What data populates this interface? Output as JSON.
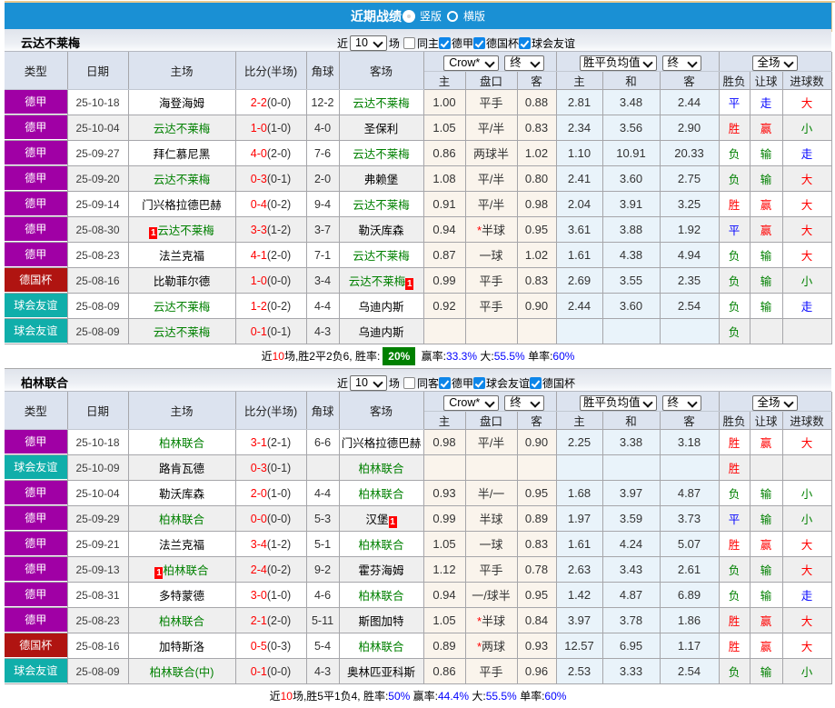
{
  "topbar": {
    "title": "近期战绩",
    "radios": [
      {
        "label": "竖版",
        "checked": true
      },
      {
        "label": "横版",
        "checked": false
      }
    ]
  },
  "colors": {
    "topbar_blue": "#1a90d4",
    "league_purple": "#a000a5",
    "cup_red": "#b01411",
    "friendly_teal": "#10aeaa",
    "header_bg": "#dce3ef",
    "asia_col_bg": "#faf4ec",
    "euro_col_bg": "#e9f3fa",
    "alt_row_bg": "#efefef",
    "win_red": "#ff0000",
    "lose_green": "#008000",
    "draw_blue": "#0000ff",
    "rate_badge_green": "#008000"
  },
  "type_colors": {
    "德甲": "#a000a5",
    "德国杯": "#b01411",
    "球会友谊": "#10aeaa"
  },
  "table_header": {
    "type": "类型",
    "date": "日期",
    "home": "主场",
    "score": "比分(半场)",
    "corner": "角球",
    "away": "客场",
    "selects": {
      "bookmaker": "Crow*",
      "final1": "终",
      "europe": "胜平负均值",
      "final2": "终",
      "scope": "全场"
    },
    "sub": [
      "主",
      "盘口",
      "客",
      "主",
      "和",
      "客",
      "胜负",
      "让球",
      "进球数"
    ]
  },
  "sections": [
    {
      "team": "云达不莱梅",
      "filter": {
        "prefix": "近",
        "count": "10",
        "suffix": "场",
        "same": {
          "label": "同主",
          "checked": false
        },
        "leagues": [
          {
            "label": "德甲",
            "checked": true
          },
          {
            "label": "德国杯",
            "checked": true
          },
          {
            "label": "球会友谊",
            "checked": true
          }
        ]
      },
      "rows": [
        {
          "type": "德甲",
          "date": "25-10-18",
          "home": {
            "name": "海登海姆"
          },
          "score": {
            "ft": "2-2",
            "ht": "(0-0)"
          },
          "corner": "12-2",
          "away": {
            "name": "云达不莱梅",
            "green": true
          },
          "asia": [
            "1.00",
            "平手",
            "0.88"
          ],
          "euro": [
            "2.81",
            "3.48",
            "2.44"
          ],
          "res": [
            [
              "平",
              "blue"
            ],
            [
              "走",
              "blue"
            ],
            [
              "大",
              "red"
            ]
          ]
        },
        {
          "type": "德甲",
          "date": "25-10-04",
          "home": {
            "name": "云达不莱梅",
            "green": true
          },
          "score": {
            "ft": "1-0",
            "ht": "(1-0)"
          },
          "corner": "4-0",
          "away": {
            "name": "圣保利"
          },
          "asia": [
            "1.05",
            "平/半",
            "0.83"
          ],
          "euro": [
            "2.34",
            "3.56",
            "2.90"
          ],
          "res": [
            [
              "胜",
              "red"
            ],
            [
              "赢",
              "red"
            ],
            [
              "小",
              "green"
            ]
          ]
        },
        {
          "type": "德甲",
          "date": "25-09-27",
          "home": {
            "name": "拜仁慕尼黑"
          },
          "score": {
            "ft": "4-0",
            "ht": "(2-0)"
          },
          "corner": "7-6",
          "away": {
            "name": "云达不莱梅",
            "green": true
          },
          "asia": [
            "0.86",
            "两球半",
            "1.02"
          ],
          "euro": [
            "1.10",
            "10.91",
            "20.33"
          ],
          "res": [
            [
              "负",
              "green"
            ],
            [
              "输",
              "green"
            ],
            [
              "走",
              "blue"
            ]
          ]
        },
        {
          "type": "德甲",
          "date": "25-09-20",
          "home": {
            "name": "云达不莱梅",
            "green": true
          },
          "score": {
            "ft": "0-3",
            "ht": "(0-1)"
          },
          "corner": "2-0",
          "away": {
            "name": "弗赖堡"
          },
          "asia": [
            "1.08",
            "平/半",
            "0.80"
          ],
          "euro": [
            "2.41",
            "3.60",
            "2.75"
          ],
          "res": [
            [
              "负",
              "green"
            ],
            [
              "输",
              "green"
            ],
            [
              "大",
              "red"
            ]
          ]
        },
        {
          "type": "德甲",
          "date": "25-09-14",
          "home": {
            "name": "门兴格拉德巴赫"
          },
          "score": {
            "ft": "0-4",
            "ht": "(0-2)"
          },
          "corner": "9-4",
          "away": {
            "name": "云达不莱梅",
            "green": true
          },
          "asia": [
            "0.91",
            "平/半",
            "0.98"
          ],
          "euro": [
            "2.04",
            "3.91",
            "3.25"
          ],
          "res": [
            [
              "胜",
              "red"
            ],
            [
              "赢",
              "red"
            ],
            [
              "大",
              "red"
            ]
          ]
        },
        {
          "type": "德甲",
          "date": "25-08-30",
          "home": {
            "name": "云达不莱梅",
            "green": true,
            "card": "1"
          },
          "score": {
            "ft": "3-3",
            "ht": "(1-2)"
          },
          "corner": "3-7",
          "away": {
            "name": "勒沃库森"
          },
          "asia": [
            "0.94",
            "*半球",
            "0.95"
          ],
          "euro": [
            "3.61",
            "3.88",
            "1.92"
          ],
          "res": [
            [
              "平",
              "blue"
            ],
            [
              "赢",
              "red"
            ],
            [
              "大",
              "red"
            ]
          ]
        },
        {
          "type": "德甲",
          "date": "25-08-23",
          "home": {
            "name": "法兰克福"
          },
          "score": {
            "ft": "4-1",
            "ht": "(2-0)"
          },
          "corner": "7-1",
          "away": {
            "name": "云达不莱梅",
            "green": true
          },
          "asia": [
            "0.87",
            "一球",
            "1.02"
          ],
          "euro": [
            "1.61",
            "4.38",
            "4.94"
          ],
          "res": [
            [
              "负",
              "green"
            ],
            [
              "输",
              "green"
            ],
            [
              "大",
              "red"
            ]
          ]
        },
        {
          "type": "德国杯",
          "date": "25-08-16",
          "home": {
            "name": "比勒菲尔德"
          },
          "score": {
            "ft": "1-0",
            "ht": "(0-0)"
          },
          "corner": "3-4",
          "away": {
            "name": "云达不莱梅",
            "green": true,
            "card": "1"
          },
          "asia": [
            "0.99",
            "平手",
            "0.83"
          ],
          "euro": [
            "2.69",
            "3.55",
            "2.35"
          ],
          "res": [
            [
              "负",
              "green"
            ],
            [
              "输",
              "green"
            ],
            [
              "小",
              "green"
            ]
          ]
        },
        {
          "type": "球会友谊",
          "date": "25-08-09",
          "home": {
            "name": "云达不莱梅",
            "green": true
          },
          "score": {
            "ft": "1-2",
            "ht": "(0-2)"
          },
          "corner": "4-4",
          "away": {
            "name": "乌迪内斯"
          },
          "asia": [
            "0.92",
            "平手",
            "0.90"
          ],
          "euro": [
            "2.44",
            "3.60",
            "2.54"
          ],
          "res": [
            [
              "负",
              "green"
            ],
            [
              "输",
              "green"
            ],
            [
              "走",
              "blue"
            ]
          ]
        },
        {
          "type": "球会友谊",
          "date": "25-08-09",
          "home": {
            "name": "云达不莱梅",
            "green": true
          },
          "score": {
            "ft": "0-1",
            "ht": "(0-1)"
          },
          "corner": "4-3",
          "away": {
            "name": "乌迪内斯"
          },
          "asia": [
            "",
            "",
            ""
          ],
          "euro": [
            "",
            "",
            ""
          ],
          "res": [
            [
              "负",
              "green"
            ],
            [
              "",
              ""
            ],
            [
              "",
              ""
            ]
          ]
        }
      ],
      "summary": [
        {
          "t": "近"
        },
        {
          "t": "10",
          "c": "red"
        },
        {
          "t": "场,胜2平2负6, 胜率:"
        },
        {
          "t": "20%",
          "badge": true
        },
        {
          "t": " 赢率:"
        },
        {
          "t": "33.3%",
          "c": "blue"
        },
        {
          "t": " 大:"
        },
        {
          "t": "55.5%",
          "c": "blue"
        },
        {
          "t": " 单率:"
        },
        {
          "t": "60%",
          "c": "blue"
        }
      ]
    },
    {
      "team": "柏林联合",
      "filter": {
        "prefix": "近",
        "count": "10",
        "suffix": "场",
        "same": {
          "label": "同客",
          "checked": false
        },
        "leagues": [
          {
            "label": "德甲",
            "checked": true
          },
          {
            "label": "球会友谊",
            "checked": true
          },
          {
            "label": "德国杯",
            "checked": true
          }
        ]
      },
      "rows": [
        {
          "type": "德甲",
          "date": "25-10-18",
          "home": {
            "name": "柏林联合",
            "green": true
          },
          "score": {
            "ft": "3-1",
            "ht": "(2-1)"
          },
          "corner": "6-6",
          "away": {
            "name": "门兴格拉德巴赫"
          },
          "asia": [
            "0.98",
            "平/半",
            "0.90"
          ],
          "euro": [
            "2.25",
            "3.38",
            "3.18"
          ],
          "res": [
            [
              "胜",
              "red"
            ],
            [
              "赢",
              "red"
            ],
            [
              "大",
              "red"
            ]
          ]
        },
        {
          "type": "球会友谊",
          "date": "25-10-09",
          "home": {
            "name": "路肯瓦德"
          },
          "score": {
            "ft": "0-3",
            "ht": "(0-1)"
          },
          "corner": "",
          "away": {
            "name": "柏林联合",
            "green": true
          },
          "asia": [
            "",
            "",
            ""
          ],
          "euro": [
            "",
            "",
            ""
          ],
          "res": [
            [
              "胜",
              "red"
            ],
            [
              "",
              ""
            ],
            [
              "",
              ""
            ]
          ]
        },
        {
          "type": "德甲",
          "date": "25-10-04",
          "home": {
            "name": "勒沃库森"
          },
          "score": {
            "ft": "2-0",
            "ht": "(1-0)"
          },
          "corner": "4-4",
          "away": {
            "name": "柏林联合",
            "green": true
          },
          "asia": [
            "0.93",
            "半/一",
            "0.95"
          ],
          "euro": [
            "1.68",
            "3.97",
            "4.87"
          ],
          "res": [
            [
              "负",
              "green"
            ],
            [
              "输",
              "green"
            ],
            [
              "小",
              "green"
            ]
          ]
        },
        {
          "type": "德甲",
          "date": "25-09-29",
          "home": {
            "name": "柏林联合",
            "green": true
          },
          "score": {
            "ft": "0-0",
            "ht": "(0-0)"
          },
          "corner": "5-3",
          "away": {
            "name": "汉堡",
            "card": "1"
          },
          "asia": [
            "0.99",
            "半球",
            "0.89"
          ],
          "euro": [
            "1.97",
            "3.59",
            "3.73"
          ],
          "res": [
            [
              "平",
              "blue"
            ],
            [
              "输",
              "green"
            ],
            [
              "小",
              "green"
            ]
          ]
        },
        {
          "type": "德甲",
          "date": "25-09-21",
          "home": {
            "name": "法兰克福"
          },
          "score": {
            "ft": "3-4",
            "ht": "(1-2)"
          },
          "corner": "5-1",
          "away": {
            "name": "柏林联合",
            "green": true
          },
          "asia": [
            "1.05",
            "一球",
            "0.83"
          ],
          "euro": [
            "1.61",
            "4.24",
            "5.07"
          ],
          "res": [
            [
              "胜",
              "red"
            ],
            [
              "赢",
              "red"
            ],
            [
              "大",
              "red"
            ]
          ]
        },
        {
          "type": "德甲",
          "date": "25-09-13",
          "home": {
            "name": "柏林联合",
            "green": true,
            "card": "1"
          },
          "score": {
            "ft": "2-4",
            "ht": "(0-2)"
          },
          "corner": "9-2",
          "away": {
            "name": "霍芬海姆"
          },
          "asia": [
            "1.12",
            "平手",
            "0.78"
          ],
          "euro": [
            "2.63",
            "3.43",
            "2.61"
          ],
          "res": [
            [
              "负",
              "green"
            ],
            [
              "输",
              "green"
            ],
            [
              "大",
              "red"
            ]
          ]
        },
        {
          "type": "德甲",
          "date": "25-08-31",
          "home": {
            "name": "多特蒙德"
          },
          "score": {
            "ft": "3-0",
            "ht": "(1-0)"
          },
          "corner": "4-6",
          "away": {
            "name": "柏林联合",
            "green": true
          },
          "asia": [
            "0.94",
            "一/球半",
            "0.95"
          ],
          "euro": [
            "1.42",
            "4.87",
            "6.89"
          ],
          "res": [
            [
              "负",
              "green"
            ],
            [
              "输",
              "green"
            ],
            [
              "走",
              "blue"
            ]
          ]
        },
        {
          "type": "德甲",
          "date": "25-08-23",
          "home": {
            "name": "柏林联合",
            "green": true
          },
          "score": {
            "ft": "2-1",
            "ht": "(2-0)"
          },
          "corner": "5-11",
          "away": {
            "name": "斯图加特"
          },
          "asia": [
            "1.05",
            "*半球",
            "0.84"
          ],
          "euro": [
            "3.97",
            "3.78",
            "1.86"
          ],
          "res": [
            [
              "胜",
              "red"
            ],
            [
              "赢",
              "red"
            ],
            [
              "大",
              "red"
            ]
          ]
        },
        {
          "type": "德国杯",
          "date": "25-08-16",
          "home": {
            "name": "加特斯洛"
          },
          "score": {
            "ft": "0-5",
            "ht": "(0-3)"
          },
          "corner": "5-4",
          "away": {
            "name": "柏林联合",
            "green": true
          },
          "asia": [
            "0.89",
            "*两球",
            "0.93"
          ],
          "euro": [
            "12.57",
            "6.95",
            "1.17"
          ],
          "res": [
            [
              "胜",
              "red"
            ],
            [
              "赢",
              "red"
            ],
            [
              "大",
              "red"
            ]
          ]
        },
        {
          "type": "球会友谊",
          "date": "25-08-09",
          "home": {
            "name": "柏林联合(中)",
            "green": true
          },
          "score": {
            "ft": "0-1",
            "ht": "(0-0)"
          },
          "corner": "4-3",
          "away": {
            "name": "奥林匹亚科斯"
          },
          "asia": [
            "0.86",
            "平手",
            "0.96"
          ],
          "euro": [
            "2.53",
            "3.33",
            "2.54"
          ],
          "res": [
            [
              "负",
              "green"
            ],
            [
              "输",
              "green"
            ],
            [
              "小",
              "green"
            ]
          ]
        }
      ],
      "summary": [
        {
          "t": "近"
        },
        {
          "t": "10",
          "c": "red"
        },
        {
          "t": "场,胜5平1负4, 胜率:"
        },
        {
          "t": "50%",
          "c": "blue"
        },
        {
          "t": " 赢率:"
        },
        {
          "t": "44.4%",
          "c": "blue"
        },
        {
          "t": " 大:"
        },
        {
          "t": "55.5%",
          "c": "blue"
        },
        {
          "t": " 单率:"
        },
        {
          "t": "60%",
          "c": "blue"
        }
      ]
    }
  ]
}
